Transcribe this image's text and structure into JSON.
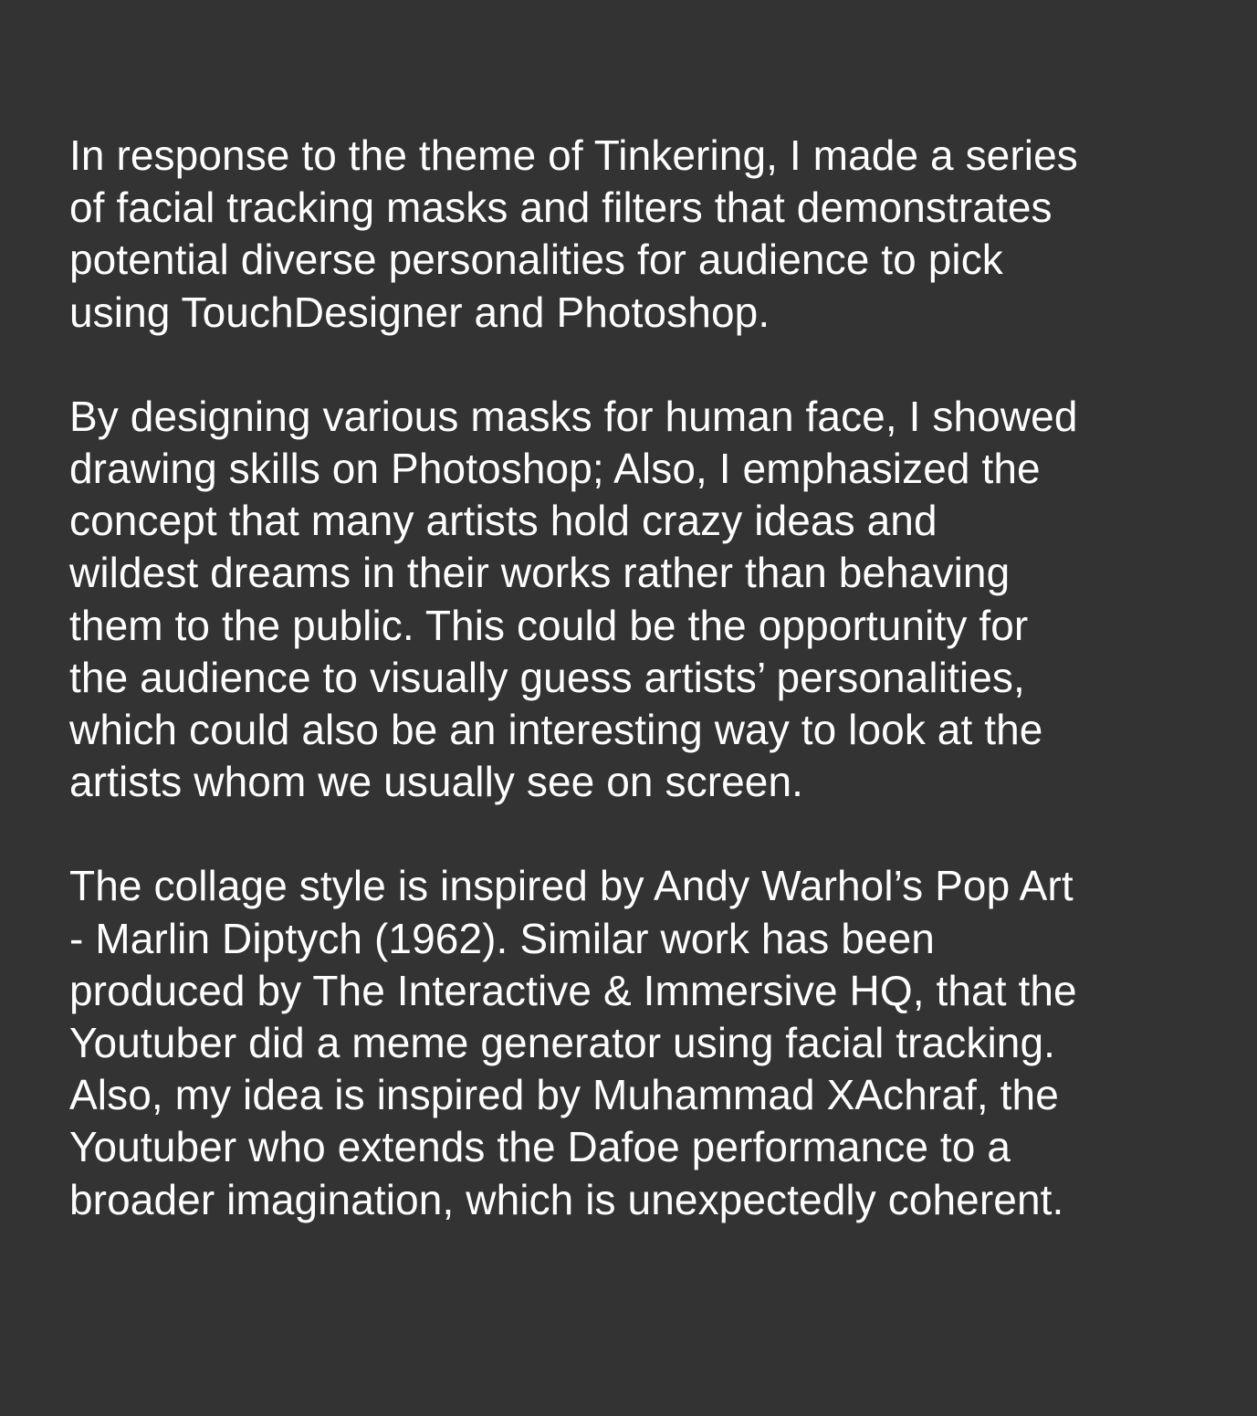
{
  "document": {
    "background_color": "#333333",
    "text_color": "#ffffff",
    "paragraphs": [
      {
        "lines": [
          "In response to the theme of Tinkering, I made a series",
          "of facial tracking masks and filters that demonstrates",
          "potential diverse personalities for audience to pick",
          "using TouchDesigner and Photoshop."
        ]
      },
      {
        "lines": [
          "By designing various masks for human face, I showed",
          "drawing skills on Photoshop; Also, I emphasized the",
          "concept that many artists hold crazy ideas and",
          "wildest dreams in their works rather than behaving",
          "them to the public. This could be the opportunity for",
          "the audience to visually guess artists’ personalities,",
          "which could also be an interesting way to look at the",
          "artists whom we usually see on screen."
        ]
      },
      {
        "lines": [
          "The collage style is inspired by Andy Warhol’s Pop Art",
          "- Marlin Diptych (1962). Similar work has been",
          "produced by The Interactive & Immersive HQ, that the",
          "Youtuber did a meme generator using facial tracking.",
          "Also, my idea is inspired by Muhammad XAchraf, the",
          "Youtuber who extends the Dafoe performance to a",
          "broader imagination, which is unexpectedly coherent."
        ]
      }
    ]
  }
}
